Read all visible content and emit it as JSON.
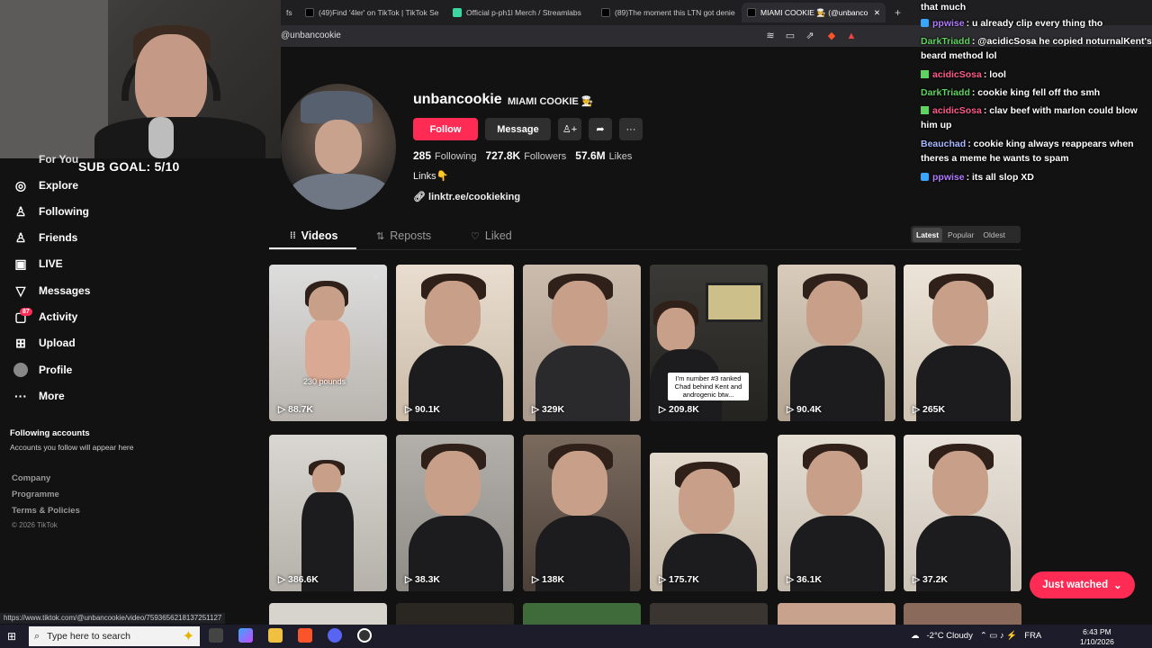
{
  "browser": {
    "tabs": [
      {
        "label": "fs"
      },
      {
        "label": "(49)Find '4ler' on TikTok | TikTok Sear"
      },
      {
        "label": "Official p-ph1l Merch / Streamlabs"
      },
      {
        "label": "(89)The moment this LTN got denied"
      },
      {
        "label": "MIAMI COOKIE 🧑‍🍳 (@unbanco"
      }
    ],
    "url": "@unbancookie"
  },
  "overlay": {
    "sub_goal": "SUB GOAL: 5/10"
  },
  "sidebar": {
    "items": [
      {
        "label": "For You",
        "icon": "home-icon"
      },
      {
        "label": "Explore",
        "icon": "compass-icon"
      },
      {
        "label": "Following",
        "icon": "user-follow-icon"
      },
      {
        "label": "Friends",
        "icon": "friends-icon"
      },
      {
        "label": "LIVE",
        "icon": "live-icon"
      },
      {
        "label": "Messages",
        "icon": "messages-icon"
      },
      {
        "label": "Activity",
        "icon": "activity-icon"
      },
      {
        "label": "Upload",
        "icon": "upload-icon"
      },
      {
        "label": "Profile",
        "icon": "avatar"
      },
      {
        "label": "More",
        "icon": "more-icon"
      }
    ],
    "activity_badge": "87",
    "following_accounts_title": "Following accounts",
    "following_accounts_sub": "Accounts you follow will appear here",
    "footer": [
      "Company",
      "Programme",
      "Terms & Policies"
    ],
    "copyright": "© 2026 TikTok"
  },
  "profile": {
    "username": "unbancookie",
    "display_name": "MIAMI COOKIE 🧑‍🍳",
    "follow_label": "Follow",
    "message_label": "Message",
    "following_count": "285",
    "following_label": "Following",
    "followers_count": "727.8K",
    "followers_label": "Followers",
    "likes_count": "57.6M",
    "likes_label": "Likes",
    "bio": "Links👇",
    "link": "linktr.ee/cookieking"
  },
  "tabs": [
    {
      "label": "Videos",
      "icon": "grid-icon"
    },
    {
      "label": "Reposts",
      "icon": "repost-icon"
    },
    {
      "label": "Liked",
      "icon": "heart-icon"
    }
  ],
  "sort": [
    "Latest",
    "Popular",
    "Oldest"
  ],
  "videos": [
    {
      "views": "88.7K",
      "caption": "230 pounds"
    },
    {
      "views": "90.1K"
    },
    {
      "views": "329K"
    },
    {
      "views": "209.8K",
      "caption": "I'm number #3 ranked Chad behind Kent and androgenic btw..."
    },
    {
      "views": "90.4K"
    },
    {
      "views": "265K"
    },
    {
      "views": "386.6K"
    },
    {
      "views": "38.3K"
    },
    {
      "views": "138K"
    },
    {
      "views": "175.7K"
    },
    {
      "views": "36.1K"
    },
    {
      "views": "37.2K"
    }
  ],
  "just_watched": "Just watched",
  "chat": [
    {
      "user": "",
      "msg": "that much"
    },
    {
      "user": "ppwise",
      "msg": ": u already clip every thing tho",
      "color": "#b07cff"
    },
    {
      "user": "DarkTriadd",
      "msg": ": @acidicSosa he copied noturnalKent's beard method lol",
      "color": "#5fd35f"
    },
    {
      "user": "acidicSosa",
      "msg": ": lool",
      "color": "#ff5c8a"
    },
    {
      "user": "DarkTriadd",
      "msg": ": cookie king fell off tho smh",
      "color": "#5fd35f"
    },
    {
      "user": "acidicSosa",
      "msg": ": clav beef with marlon could blow him up",
      "color": "#ff5c8a"
    },
    {
      "user": "Beauchad",
      "msg": ": cookie king always reappears when theres a meme he wants to spam",
      "color": "#a9b8ff"
    },
    {
      "user": "ppwise",
      "msg": ": its all slop XD",
      "color": "#b07cff"
    }
  ],
  "status_url": "https://www.tiktok.com/@unbancookie/video/7593656218137251127",
  "taskbar": {
    "search_placeholder": "Type here to search",
    "weather": "-2°C  Cloudy",
    "lang": "FRA",
    "time": "6:43 PM",
    "date": "1/10/2026"
  },
  "colors": {
    "accent": "#fe2c55",
    "background": "#121212"
  }
}
